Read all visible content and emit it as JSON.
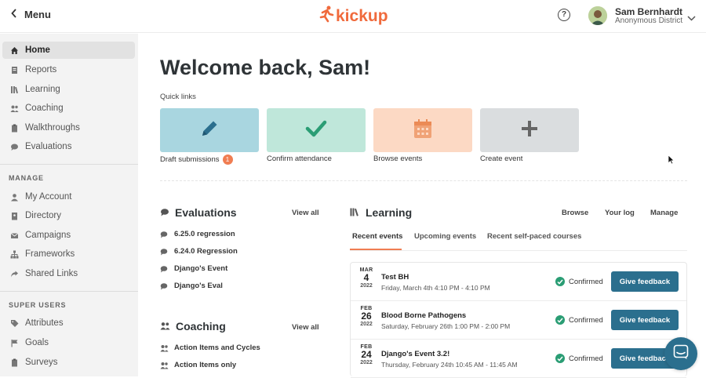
{
  "topbar": {
    "menu_label": "Menu",
    "logo_text": "kickup",
    "help_label": "?",
    "user_name": "Sam Bernhardt",
    "user_org": "Anonymous District"
  },
  "sidebar": {
    "main_items": [
      {
        "label": "Home",
        "icon": "home-icon",
        "active": true
      },
      {
        "label": "Reports",
        "icon": "report-icon"
      },
      {
        "label": "Learning",
        "icon": "books-icon"
      },
      {
        "label": "Coaching",
        "icon": "people-icon"
      },
      {
        "label": "Walkthroughs",
        "icon": "clipboard-icon"
      },
      {
        "label": "Evaluations",
        "icon": "chat-icon"
      }
    ],
    "manage_title": "MANAGE",
    "manage_items": [
      {
        "label": "My Account",
        "icon": "user-icon"
      },
      {
        "label": "Directory",
        "icon": "book-icon"
      },
      {
        "label": "Campaigns",
        "icon": "mail-icon"
      },
      {
        "label": "Frameworks",
        "icon": "hierarchy-icon"
      },
      {
        "label": "Shared Links",
        "icon": "share-icon"
      }
    ],
    "super_title": "SUPER USERS",
    "super_items": [
      {
        "label": "Attributes",
        "icon": "tag-icon"
      },
      {
        "label": "Goals",
        "icon": "flag-icon"
      },
      {
        "label": "Surveys",
        "icon": "clipboard-icon"
      }
    ]
  },
  "main": {
    "welcome": "Welcome back, Sam!",
    "quick_links_label": "Quick links",
    "quick_links": [
      {
        "label": "Draft submissions",
        "badge": "1",
        "icon": "pencil-icon",
        "color": "#a9d6e0"
      },
      {
        "label": "Confirm attendance",
        "icon": "check-icon",
        "color": "#bfe7da"
      },
      {
        "label": "Browse events",
        "icon": "calendar-icon",
        "color": "#fcd9c4"
      },
      {
        "label": "Create event",
        "icon": "plus-icon",
        "color": "#dadddf"
      }
    ],
    "evaluations": {
      "title": "Evaluations",
      "view_all": "View all",
      "items": [
        "6.25.0 regression",
        "6.24.0 Regression",
        "Django's Event",
        "Django's Eval"
      ]
    },
    "coaching": {
      "title": "Coaching",
      "view_all": "View all",
      "items": [
        "Action Items and Cycles",
        "Action Items only"
      ]
    },
    "learning": {
      "title": "Learning",
      "links": [
        "Browse",
        "Your log",
        "Manage"
      ],
      "tabs": [
        "Recent events",
        "Upcoming events",
        "Recent self-paced courses"
      ],
      "events": [
        {
          "month": "MAR",
          "day": "4",
          "year": "2022",
          "name": "Test BH",
          "time": "Friday, March 4th 4:10 PM - 4:10 PM",
          "status": "Confirmed",
          "action": "Give feedback"
        },
        {
          "month": "FEB",
          "day": "26",
          "year": "2022",
          "name": "Blood Borne Pathogens",
          "time": "Saturday, February 26th 1:00 PM - 2:00 PM",
          "status": "Confirmed",
          "action": "Give feedback"
        },
        {
          "month": "FEB",
          "day": "24",
          "year": "2022",
          "name": "Django's Event 3.2!",
          "time": "Thursday, February 24th 10:45 AM - 11:45 AM",
          "status": "Confirmed",
          "action": "Give feedback"
        }
      ]
    }
  },
  "colors": {
    "brand_orange": "#f06a3c",
    "button_blue": "#2b6f8e",
    "confirmed_green": "#2a9d74"
  }
}
